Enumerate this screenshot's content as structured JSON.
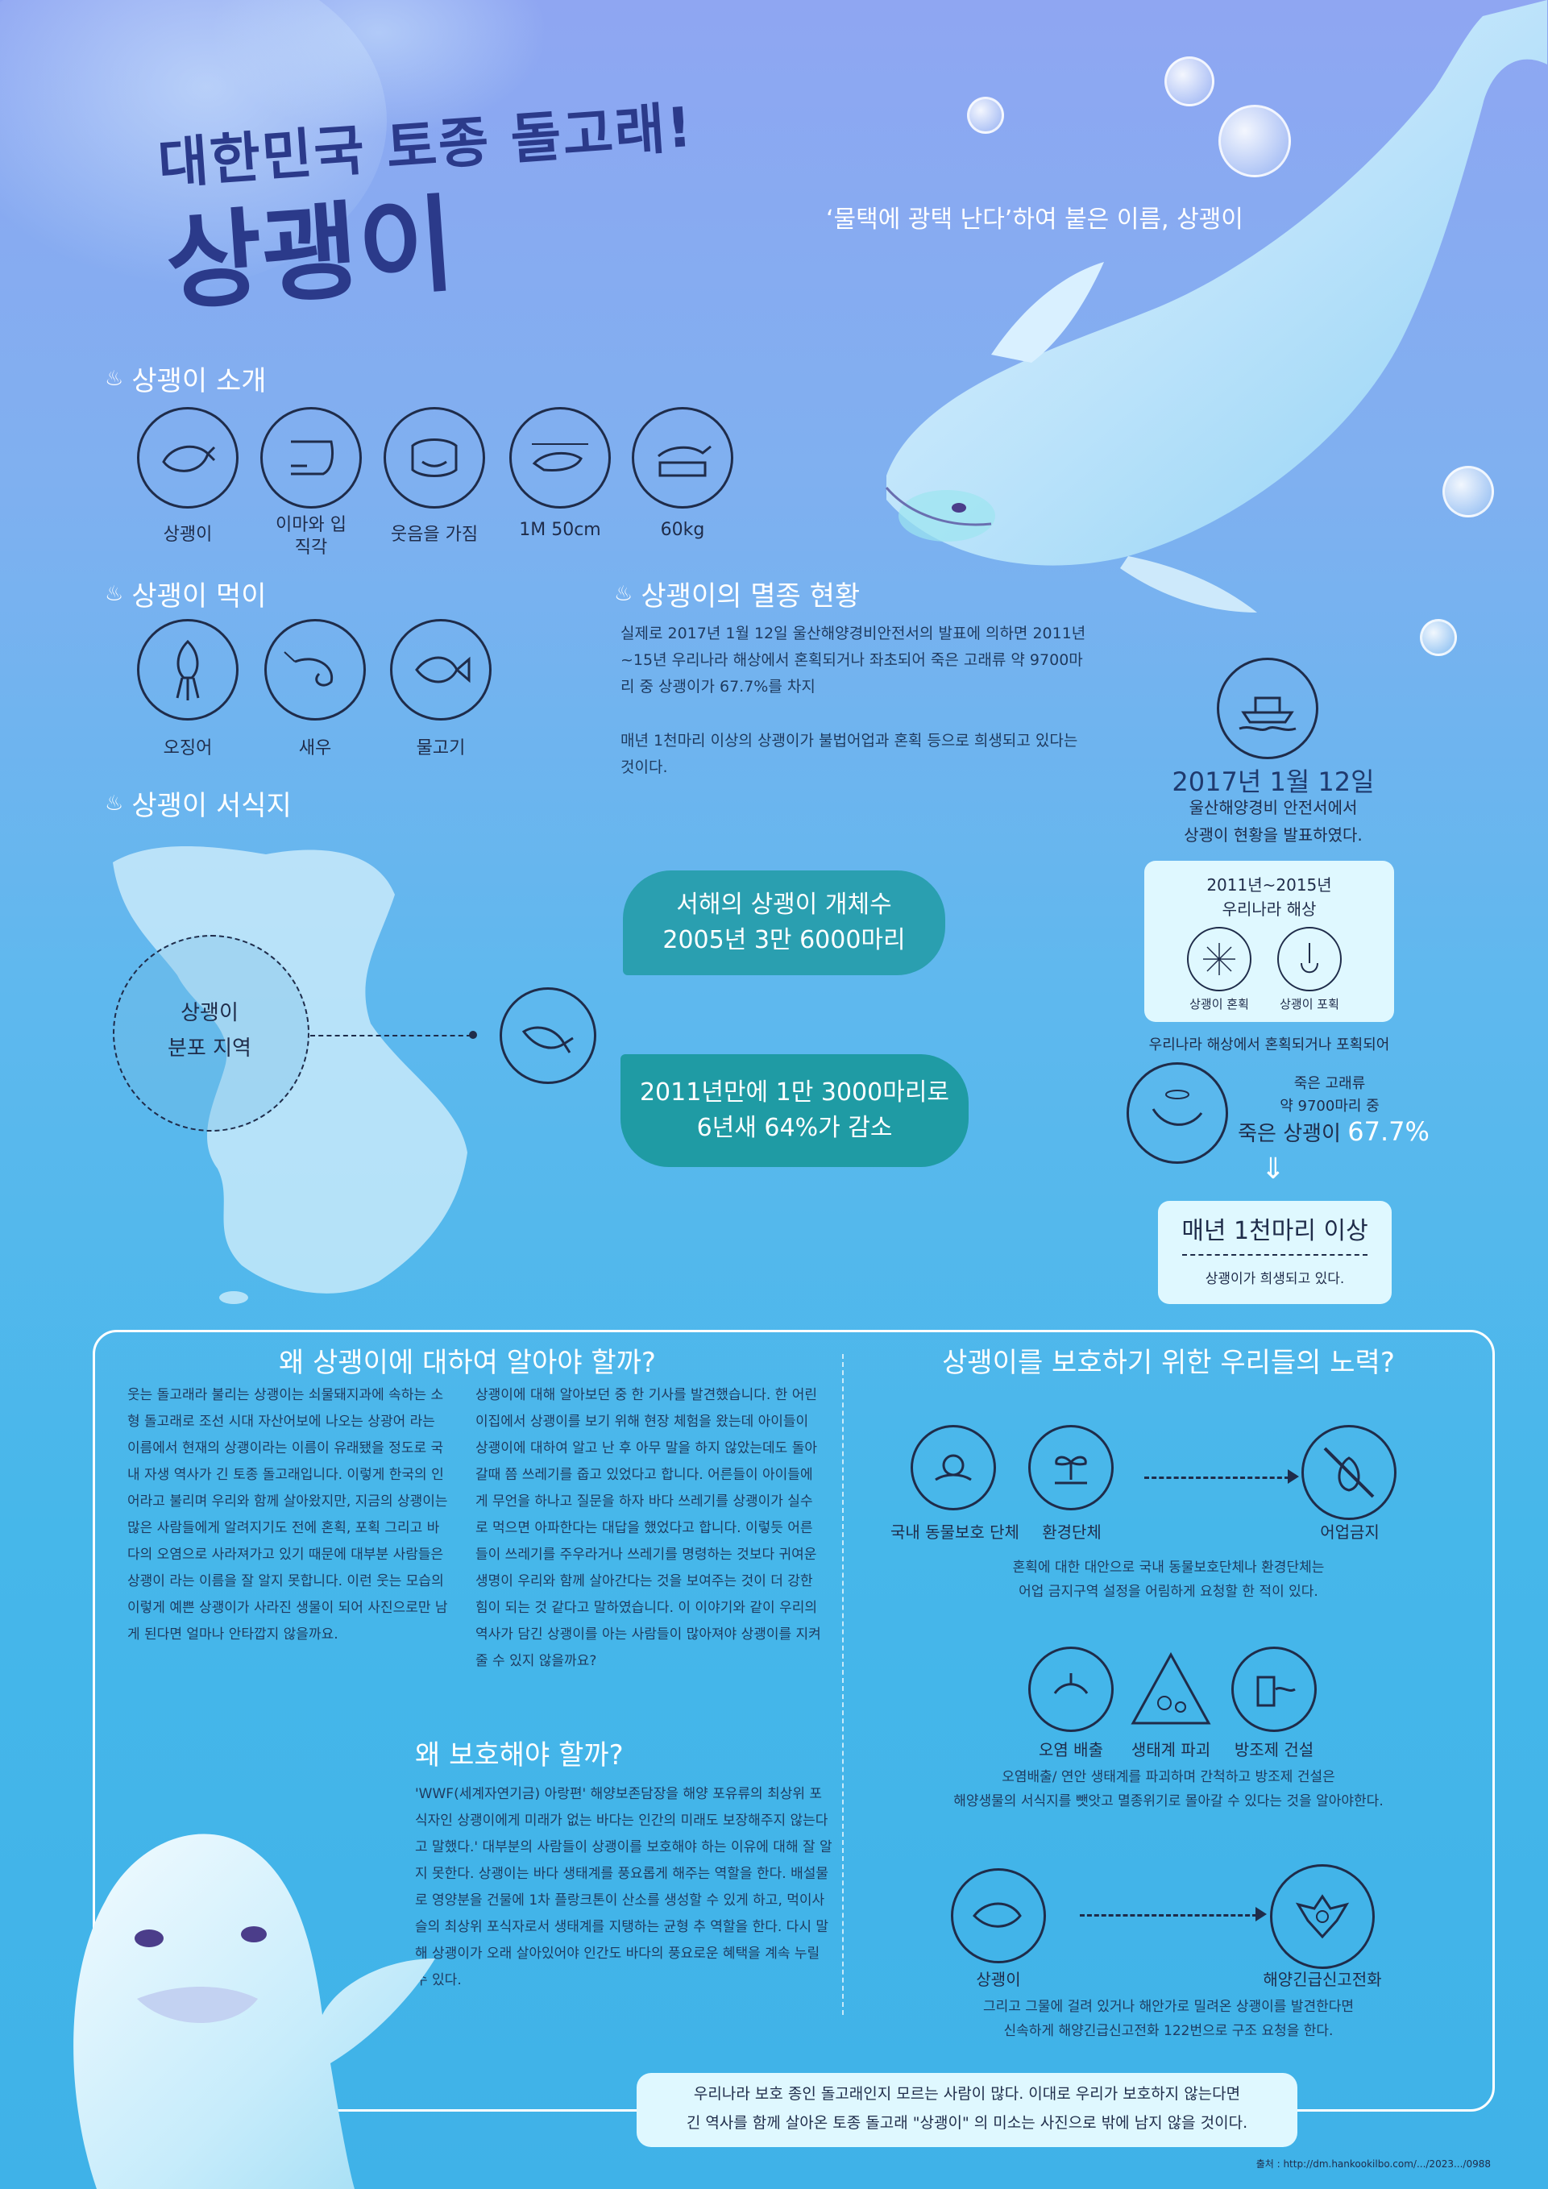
{
  "header": {
    "subtitle": "대한민국 토종 돌고래!",
    "title": "상괭이",
    "name_origin": "‘물택에 광택 난다’하여 붙은 이름, 상괭이"
  },
  "intro": {
    "heading": "상괭이 소개",
    "items": [
      {
        "icon": "porpoise-icon",
        "label": "상괭이"
      },
      {
        "icon": "forehead-icon",
        "label": "이마와 입\n직각"
      },
      {
        "icon": "smile-icon",
        "label": "웃음을 가짐"
      },
      {
        "icon": "length-icon",
        "label": "1M 50cm"
      },
      {
        "icon": "scale-icon",
        "label": "60kg"
      }
    ]
  },
  "food": {
    "heading": "상괭이 먹이",
    "items": [
      {
        "icon": "squid-icon",
        "label": "오징어"
      },
      {
        "icon": "shrimp-icon",
        "label": "새우"
      },
      {
        "icon": "fish-icon",
        "label": "물고기"
      }
    ]
  },
  "habitat": {
    "heading": "상괭이 서식지",
    "area_label": "상괭이\n분포 지역"
  },
  "status": {
    "heading": "상괭이의 멸종 현황",
    "p1": "실제로 2017년 1월 12일 울산해양경비안전서의 발표에 의하면 2011년~15년 우리나라 해상에서 혼획되거나 좌초되어 죽은 고래류 약 9700마리 중 상괭이가 67.7%를 차지",
    "p2": "매년 1천마리 이상의 상괭이가 불법어업과 혼획 등으로 희생되고 있다는 것이다.",
    "bubble1": "서해의 상괭이 개체수\n2005년 3만 6000마리",
    "bubble2": "2011년만에 1만 3000마리로\n6년새 64%가 감소"
  },
  "timeline": {
    "date": "2017년 1월 12일",
    "date_sub": "울산해양경비 안전서에서\n상괭이 현황을 발표하였다.",
    "box_title": "2011년~2015년\n우리나라 해상",
    "box_item1": "상괭이 혼획",
    "box_item2": "상괭이 포획",
    "note": "우리나라 해상에서 혼획되거나 포획되어",
    "dead1": "죽은 고래류",
    "dead2": "약 9700마리 중",
    "dead3": "죽은 상괭이",
    "dead_pct": "67.7%",
    "arrow": "⇓",
    "annual": "매년 1천마리 이상",
    "annual_sub": "상괭이가 희생되고 있다."
  },
  "why": {
    "heading": "왜 상괭이에 대하여 알아야 할까?",
    "col1": "웃는 돌고래라 불리는 상괭이는 쇠물돼지과에 속하는 소형 돌고래로 조선 시대 자산어보에 나오는 상광어 라는 이름에서 현재의 상괭이라는 이름이 유래됐을 정도로 국내 자생 역사가 긴 토종 돌고래입니다. 이렇게 한국의 인어라고 불리며 우리와 함께 살아왔지만, 지금의 상괭이는 많은 사람들에게 알려지기도 전에 혼획, 포획 그리고 바다의 오염으로 사라져가고 있기 때문에 대부분 사람들은 상괭이 라는 이름을 잘 알지 못합니다. 이런 웃는 모습의 이렇게 예쁜 상괭이가 사라진 생물이 되어 사진으로만 남게 된다면 얼마나 안타깝지 않을까요.",
    "col2": "상괭이에 대해 알아보던 중 한 기사를 발견했습니다. 한 어린이집에서 상괭이를 보기 위해 현장 체험을 왔는데 아이들이 상괭이에 대하여 알고 난 후 아무 말을 하지 않았는데도 돌아갈때 쯤 쓰레기를 줍고 있었다고 합니다. 어른들이 아이들에게 무언을 하나고 질문을 하자 바다 쓰레기를 상괭이가 실수로 먹으면 아파한다는 대답을 했었다고 합니다. 이렇듯 어른들이 쓰레기를 주우라거나 쓰레기를 명령하는 것보다 귀여운 생명이 우리와 함께 살아간다는 것을 보여주는 것이 더 강한 힘이 되는 것 같다고 말하였습니다. 이 이야기와 같이 우리의 역사가 담긴 상괭이를 아는 사람들이 많아져야 상괭이를 지켜줄 수 있지 않을까요?"
  },
  "protect": {
    "heading": "왜 보호해야 할까?",
    "body": "'WWF(세계자연기금) 아랑편' 해양보존담장을 해양 포유류의 최상위 포식자인 상괭이에게 미래가 없는 바다는 인간의 미래도 보장해주지 않는다고 말했다.' 대부분의 사람들이 상괭이를 보호해야 하는 이유에 대해 잘 알지 못한다. 상괭이는 바다 생태계를 풍요롭게 해주는 역할을 한다. 배설물로 영양분을 건물에 1차 플랑크톤이 산소를 생성할 수 있게 하고, 먹이사슬의 최상위 포식자로서 생태계를 지탱하는 균형 추 역할을 한다. 다시 말해 상괭이가 오래 살아있어야 인간도 바다의 풍요로운 혜택을 계속 누릴 수 있다."
  },
  "effort": {
    "heading": "상괭이를 보호하기 위한 우리들의 노력?",
    "row1": {
      "a": "국내 동물보호 단체",
      "b": "환경단체",
      "c": "어업금지",
      "text": "혼획에 대한 대안으로 국내 동물보호단체나 환경단체는\n어업 금지구역 설정을 어림하게 요청할 한 적이 있다."
    },
    "row2": {
      "a": "오염 배출",
      "b": "생태계 파괴",
      "c": "방조제 건설",
      "text": "오염배출/ 연안 생태계를 파괴하며 간척하고 방조제 건설은\n해양생물의 서식지를 뺏앗고 멸종위기로 몰아갈 수 있다는 것을 알아야한다."
    },
    "row3": {
      "a": "상괭이",
      "b": "해양긴급신고전화",
      "text": "그리고 그물에 걸려 있거나 해안가로 밀려온 상괭이를 발견한다면\n신속하게 해양긴급신고전화 122번으로 구조 요청을 한다."
    }
  },
  "footer": {
    "message": "우리나라 보호 종인 돌고래인지 모르는 사람이 많다. 이대로 우리가 보호하지 않는다면\n긴 역사를 함께 살아온 토종 돌고래 \"상괭이\" 의 미소는 사진으로 밖에 남지 않을 것이다.",
    "source": "출처 : http://dm.hankookilbo.com/.../2023.../0988"
  },
  "colors": {
    "teal": "#1f9fa6",
    "navy": "#1f2c4a",
    "panel": "#dff8ff"
  }
}
